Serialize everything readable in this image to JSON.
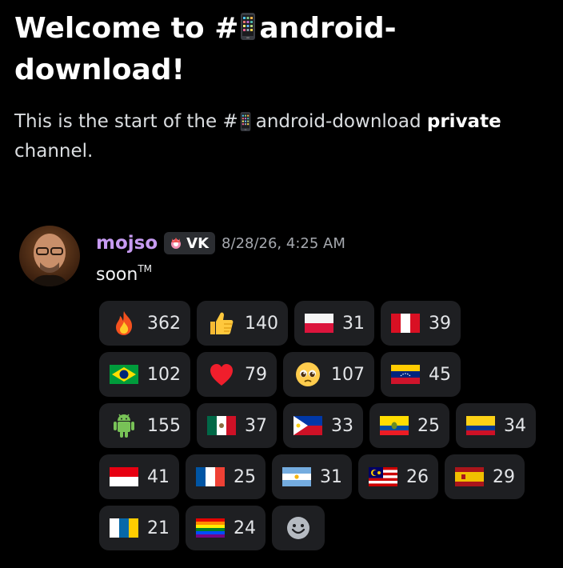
{
  "channel": {
    "welcome_prefix": "Welcome to #",
    "welcome_name": "android-",
    "welcome_name_2": "download!",
    "intro_prefix": "This is the start of the #",
    "intro_name": "android-download",
    "intro_private": "private",
    "intro_suffix": "channel."
  },
  "message": {
    "author": "mojso",
    "tag": "VK",
    "timestamp": "8/28/26, 4:25 AM",
    "text": "soon",
    "text_sup": "TM",
    "author_color": "#c79bf2"
  },
  "reactions": [
    {
      "emoji": "fire",
      "count": "362"
    },
    {
      "emoji": "thumbs-up",
      "count": "140"
    },
    {
      "emoji": "flag-poland",
      "count": "31"
    },
    {
      "emoji": "flag-peru",
      "count": "39"
    },
    {
      "emoji": "flag-brazil",
      "count": "102"
    },
    {
      "emoji": "red-heart",
      "count": "79"
    },
    {
      "emoji": "pleading-face",
      "count": "107"
    },
    {
      "emoji": "flag-venezuela",
      "count": "45"
    },
    {
      "emoji": "android-robot",
      "count": "155"
    },
    {
      "emoji": "flag-mexico",
      "count": "37"
    },
    {
      "emoji": "flag-philippines",
      "count": "33"
    },
    {
      "emoji": "flag-ecuador",
      "count": "25"
    },
    {
      "emoji": "flag-colombia",
      "count": "34"
    },
    {
      "emoji": "flag-indonesia",
      "count": "41"
    },
    {
      "emoji": "flag-france",
      "count": "25"
    },
    {
      "emoji": "flag-argentina",
      "count": "31"
    },
    {
      "emoji": "flag-malaysia",
      "count": "26"
    },
    {
      "emoji": "flag-spain",
      "count": "29"
    },
    {
      "emoji": "flag-canary-islands",
      "count": "21"
    },
    {
      "emoji": "flag-rainbow",
      "count": "24"
    }
  ],
  "add_reaction_icon": "add-reaction-icon"
}
